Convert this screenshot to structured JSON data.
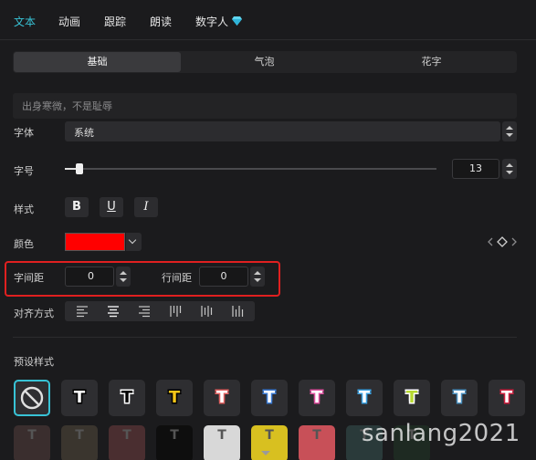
{
  "tabs": [
    "文本",
    "动画",
    "跟踪",
    "朗读",
    "数字人"
  ],
  "active_tab": "文本",
  "subtabs": [
    "基础",
    "气泡",
    "花字"
  ],
  "text_input": {
    "value": "出身寒微，不是耻辱"
  },
  "font": {
    "label": "字体",
    "value": "系统"
  },
  "font_size": {
    "label": "字号",
    "value": "13"
  },
  "style": {
    "label": "样式",
    "bold": "B",
    "underline": "U",
    "italic": "I"
  },
  "color": {
    "label": "颜色",
    "value": "#ff0000"
  },
  "spacing": {
    "char_label": "字间距",
    "char_value": "0",
    "line_label": "行间距",
    "line_value": "0"
  },
  "align": {
    "label": "对齐方式"
  },
  "presets": {
    "title": "预设样式",
    "glyph": "T",
    "row1": [
      {
        "fill": "#ffffff",
        "stroke": "#000000",
        "bg": "#2e2e31"
      },
      {
        "fill": "#000000",
        "stroke": "#ffffff",
        "bg": "#2e2e31"
      },
      {
        "fill": "#f5c518",
        "stroke": "#000000",
        "bg": "#2e2e31"
      },
      {
        "fill": "#ffffff",
        "stroke": "#e06060",
        "bg": "#2e2e31"
      },
      {
        "fill": "#ffffff",
        "stroke": "#3a7bd5",
        "bg": "#2e2e31"
      },
      {
        "fill": "#ffffff",
        "stroke": "#e050a0",
        "bg": "#2e2e31"
      },
      {
        "fill": "#ffffff",
        "stroke": "#3aa0e0",
        "bg": "#2e2e31"
      },
      {
        "fill": "#b6d830",
        "stroke": "#ffffff",
        "bg": "#2e2e31"
      },
      {
        "fill": "#ffffff",
        "stroke": "#4a90c0",
        "bg": "#2e2e31"
      },
      {
        "fill": "#ffffff",
        "stroke": "#d02040",
        "bg": "#2e2e31"
      }
    ],
    "row2": [
      {
        "bg": "#3a2e2e"
      },
      {
        "bg": "#3a352e"
      },
      {
        "bg": "#4a2e30"
      },
      {
        "bg": "#0e0e0e"
      },
      {
        "bg": "#d8d8d8"
      },
      {
        "bg": "#d8c020"
      },
      {
        "bg": "#c85058"
      },
      {
        "bg": "#2a3a3a"
      },
      {
        "bg": "#1e2a22"
      }
    ]
  },
  "watermark": "sanlang2021"
}
